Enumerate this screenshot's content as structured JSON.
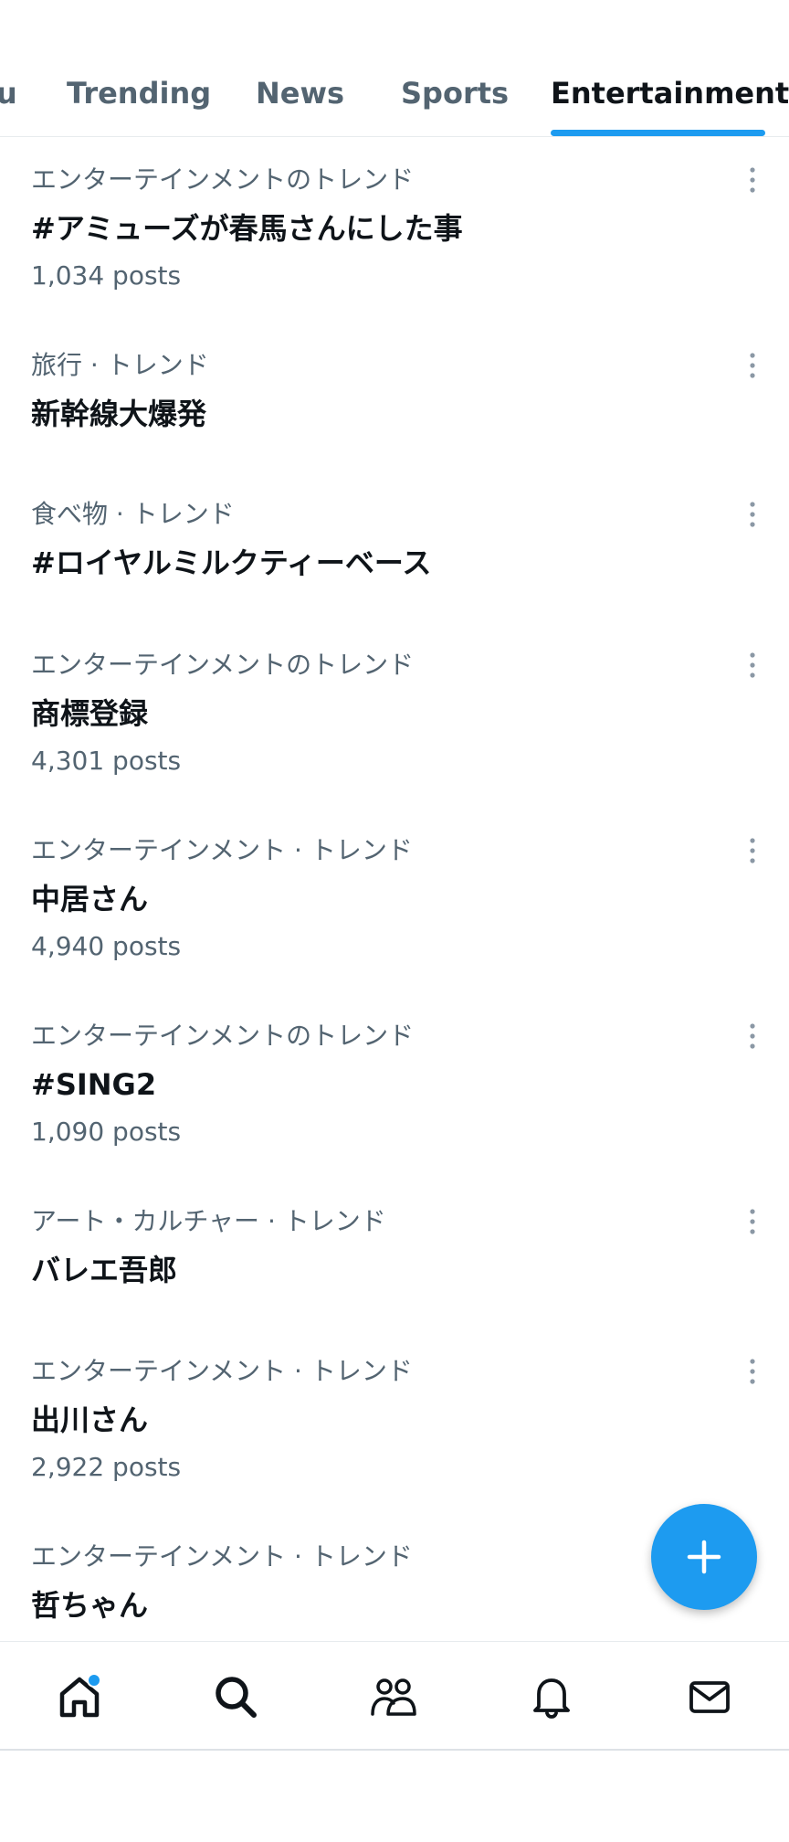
{
  "tabs": {
    "partial": "u",
    "trending": "Trending",
    "news": "News",
    "sports": "Sports",
    "entertainment": "Entertainment",
    "active": "Entertainment"
  },
  "trends": [
    {
      "category": "エンターテインメントのトレンド",
      "title": "#アミューズが春馬さんにした事",
      "posts": "1,034 posts"
    },
    {
      "category": "旅行 · トレンド",
      "title": "新幹線大爆発",
      "posts": ""
    },
    {
      "category": "食べ物 · トレンド",
      "title": "#ロイヤルミルクティーベース",
      "posts": ""
    },
    {
      "category": "エンターテインメントのトレンド",
      "title": "商標登録",
      "posts": "4,301 posts"
    },
    {
      "category": "エンターテインメント · トレンド",
      "title": "中居さん",
      "posts": "4,940 posts"
    },
    {
      "category": "エンターテインメントのトレンド",
      "title": "#SING2",
      "posts": "1,090 posts"
    },
    {
      "category": "アート・カルチャー · トレンド",
      "title": "バレエ吾郎",
      "posts": ""
    },
    {
      "category": "エンターテインメント · トレンド",
      "title": "出川さん",
      "posts": "2,922 posts"
    },
    {
      "category": "エンターテインメント · トレンド",
      "title": "哲ちゃん",
      "posts": ""
    }
  ],
  "icons": {
    "more": "more-vertical-icon",
    "fab": "plus-icon",
    "home": "home-icon",
    "search": "search-icon",
    "communities": "people-icon",
    "notifications": "bell-icon",
    "messages": "mail-icon"
  },
  "colors": {
    "accent": "#1d9bf0",
    "text_primary": "#0f1419",
    "text_secondary": "#536471"
  },
  "badges": {
    "home_unread_dot": true
  }
}
